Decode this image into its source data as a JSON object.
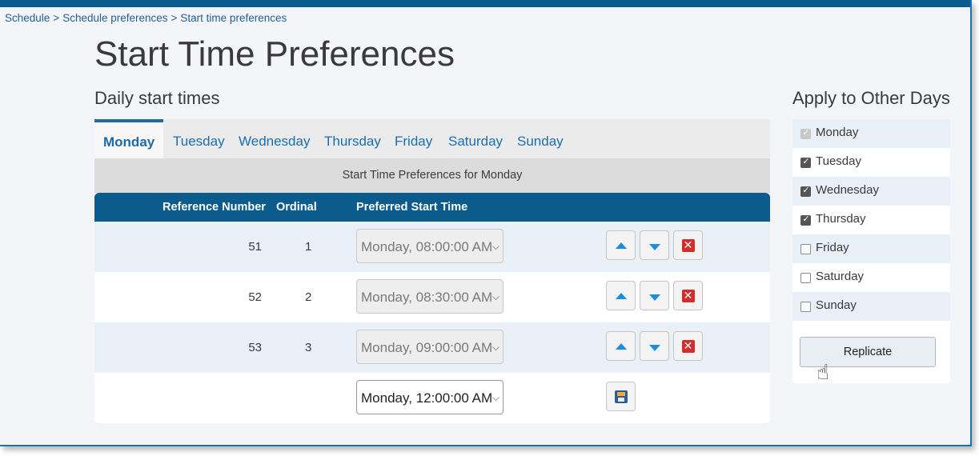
{
  "breadcrumb": [
    "Schedule",
    "Schedule preferences",
    "Start time preferences"
  ],
  "breadcrumb_sep": ">",
  "page_title": "Start Time Preferences",
  "section_title": "Daily start times",
  "tabs": [
    "Monday",
    "Tuesday",
    "Wednesday",
    "Thursday",
    "Friday",
    "Saturday",
    "Sunday"
  ],
  "active_tab": "Monday",
  "subheader": "Start Time Preferences for Monday",
  "columns": {
    "ref": "Reference Number",
    "ordinal": "Ordinal",
    "time": "Preferred Start Time"
  },
  "rows": [
    {
      "ref": "51",
      "ordinal": "1",
      "time": "Monday, 08:00:00 AM"
    },
    {
      "ref": "52",
      "ordinal": "2",
      "time": "Monday, 08:30:00 AM"
    },
    {
      "ref": "53",
      "ordinal": "3",
      "time": "Monday, 09:00:00 AM"
    }
  ],
  "new_row": {
    "time": "Monday, 12:00:00 AM"
  },
  "apply": {
    "title": "Apply to Other Days",
    "days": [
      {
        "label": "Monday",
        "checked": true,
        "disabled": true
      },
      {
        "label": "Tuesday",
        "checked": true,
        "disabled": false
      },
      {
        "label": "Wednesday",
        "checked": true,
        "disabled": false
      },
      {
        "label": "Thursday",
        "checked": true,
        "disabled": false
      },
      {
        "label": "Friday",
        "checked": false,
        "disabled": false
      },
      {
        "label": "Saturday",
        "checked": false,
        "disabled": false
      },
      {
        "label": "Sunday",
        "checked": false,
        "disabled": false
      }
    ],
    "button": "Replicate"
  },
  "colors": {
    "accent": "#0b5b8c",
    "link": "#1a6fb0",
    "delete": "#d12d2d",
    "arrow": "#1c8fdc"
  },
  "icons": {
    "up": "arrow-up-icon",
    "down": "arrow-down-icon",
    "delete": "delete-icon",
    "save": "save-icon",
    "cursor": "hand-pointer-icon"
  }
}
